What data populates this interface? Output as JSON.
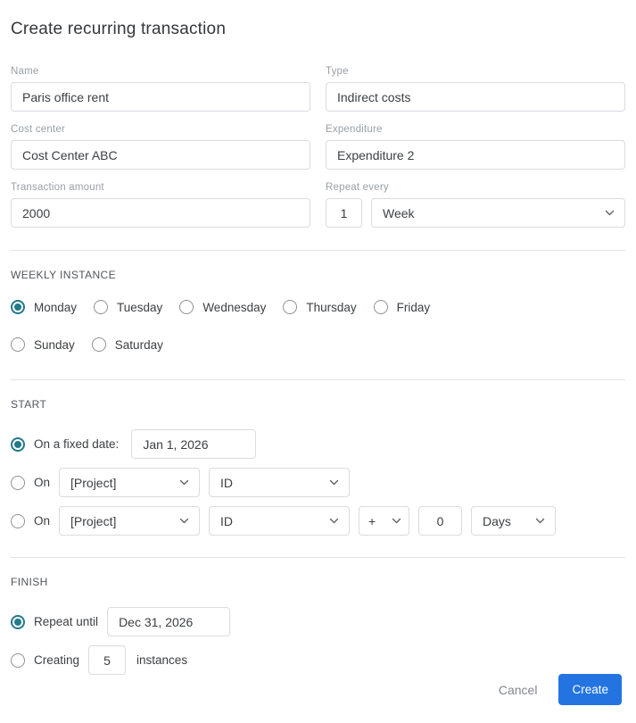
{
  "title": "Create recurring transaction",
  "colors": {
    "radio_accent": "#227a8a",
    "primary_button": "#2374e1",
    "input_border": "#dadce0"
  },
  "fields": {
    "name": {
      "label": "Name",
      "value": "Paris office rent"
    },
    "type": {
      "label": "Type",
      "value": "Indirect costs"
    },
    "cost_center": {
      "label": "Cost center",
      "value": "Cost Center ABC"
    },
    "expenditure": {
      "label": "Expenditure",
      "value": "Expenditure 2"
    },
    "transaction_amount": {
      "label": "Transaction amount",
      "value": "2000"
    },
    "repeat_every": {
      "label": "Repeat every",
      "interval": "1",
      "unit": "Week"
    }
  },
  "weekly_instance": {
    "heading": "WEEKLY INSTANCE",
    "days": [
      {
        "label": "Monday",
        "selected": true
      },
      {
        "label": "Tuesday",
        "selected": false
      },
      {
        "label": "Wednesday",
        "selected": false
      },
      {
        "label": "Thursday",
        "selected": false
      },
      {
        "label": "Friday",
        "selected": false
      },
      {
        "label": "Sunday",
        "selected": false
      },
      {
        "label": "Saturday",
        "selected": false
      }
    ]
  },
  "start": {
    "heading": "START",
    "fixed_date": {
      "radio_label": "On a fixed date:",
      "selected": true,
      "value": "Jan 1, 2026"
    },
    "on_event": {
      "radio_label": "On",
      "selected": false,
      "project": "[Project]",
      "reference": "ID"
    },
    "on_event_offset": {
      "radio_label": "On",
      "selected": false,
      "project": "[Project]",
      "reference": "ID",
      "operator": "+",
      "offset": "0",
      "offset_unit": "Days"
    }
  },
  "finish": {
    "heading": "FINISH",
    "repeat_until": {
      "radio_label": "Repeat until",
      "selected": true,
      "value": "Dec 31, 2026"
    },
    "creating": {
      "radio_label": "Creating",
      "selected": false,
      "count": "5",
      "suffix": "instances"
    }
  },
  "footer": {
    "cancel_label": "Cancel",
    "create_label": "Create"
  }
}
